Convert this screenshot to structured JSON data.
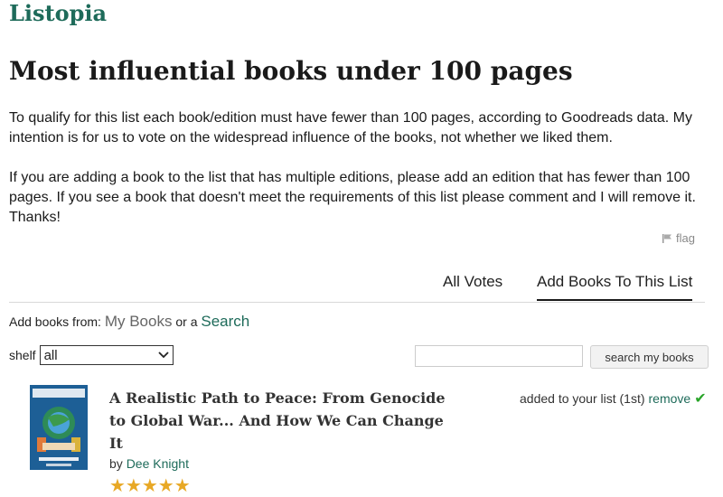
{
  "brand": "Listopia",
  "page_title": "Most influential books under 100 pages",
  "description": [
    "To qualify for this list each book/edition must have fewer than 100 pages, according to Goodreads data. My intention is for us to vote on the widespread influence of the books, not whether we liked them.",
    "If you are adding a book to the list that has multiple editions, please add an edition that has fewer than 100 pages. If you see a book that doesn't meet the requirements of this list please comment and I will remove it. Thanks!"
  ],
  "flag_label": "flag",
  "tabs": [
    {
      "label": "All Votes",
      "active": false
    },
    {
      "label": "Add Books To This List",
      "active": true
    }
  ],
  "add_from": {
    "prefix": "Add books from:",
    "my_books": "My Books",
    "or_a": "or a",
    "search": "Search"
  },
  "shelf": {
    "label": "shelf",
    "selected": "all"
  },
  "search": {
    "value": "",
    "button": "search my books"
  },
  "book": {
    "title": "A Realistic Path to Peace: From Genocide to Global War... And How We Can Change It",
    "by": "by",
    "author": "Dee Knight",
    "rating_stars": 5,
    "stars": "★★★★★",
    "status_text": "added to your list (1st)",
    "remove_label": "remove"
  },
  "colors": {
    "brand_green": "#1e6b5a",
    "star": "#e8a825",
    "check": "#2aa52a"
  },
  "icons": [
    "flag-icon",
    "chevron-down-icon",
    "check-icon",
    "star-icon"
  ]
}
